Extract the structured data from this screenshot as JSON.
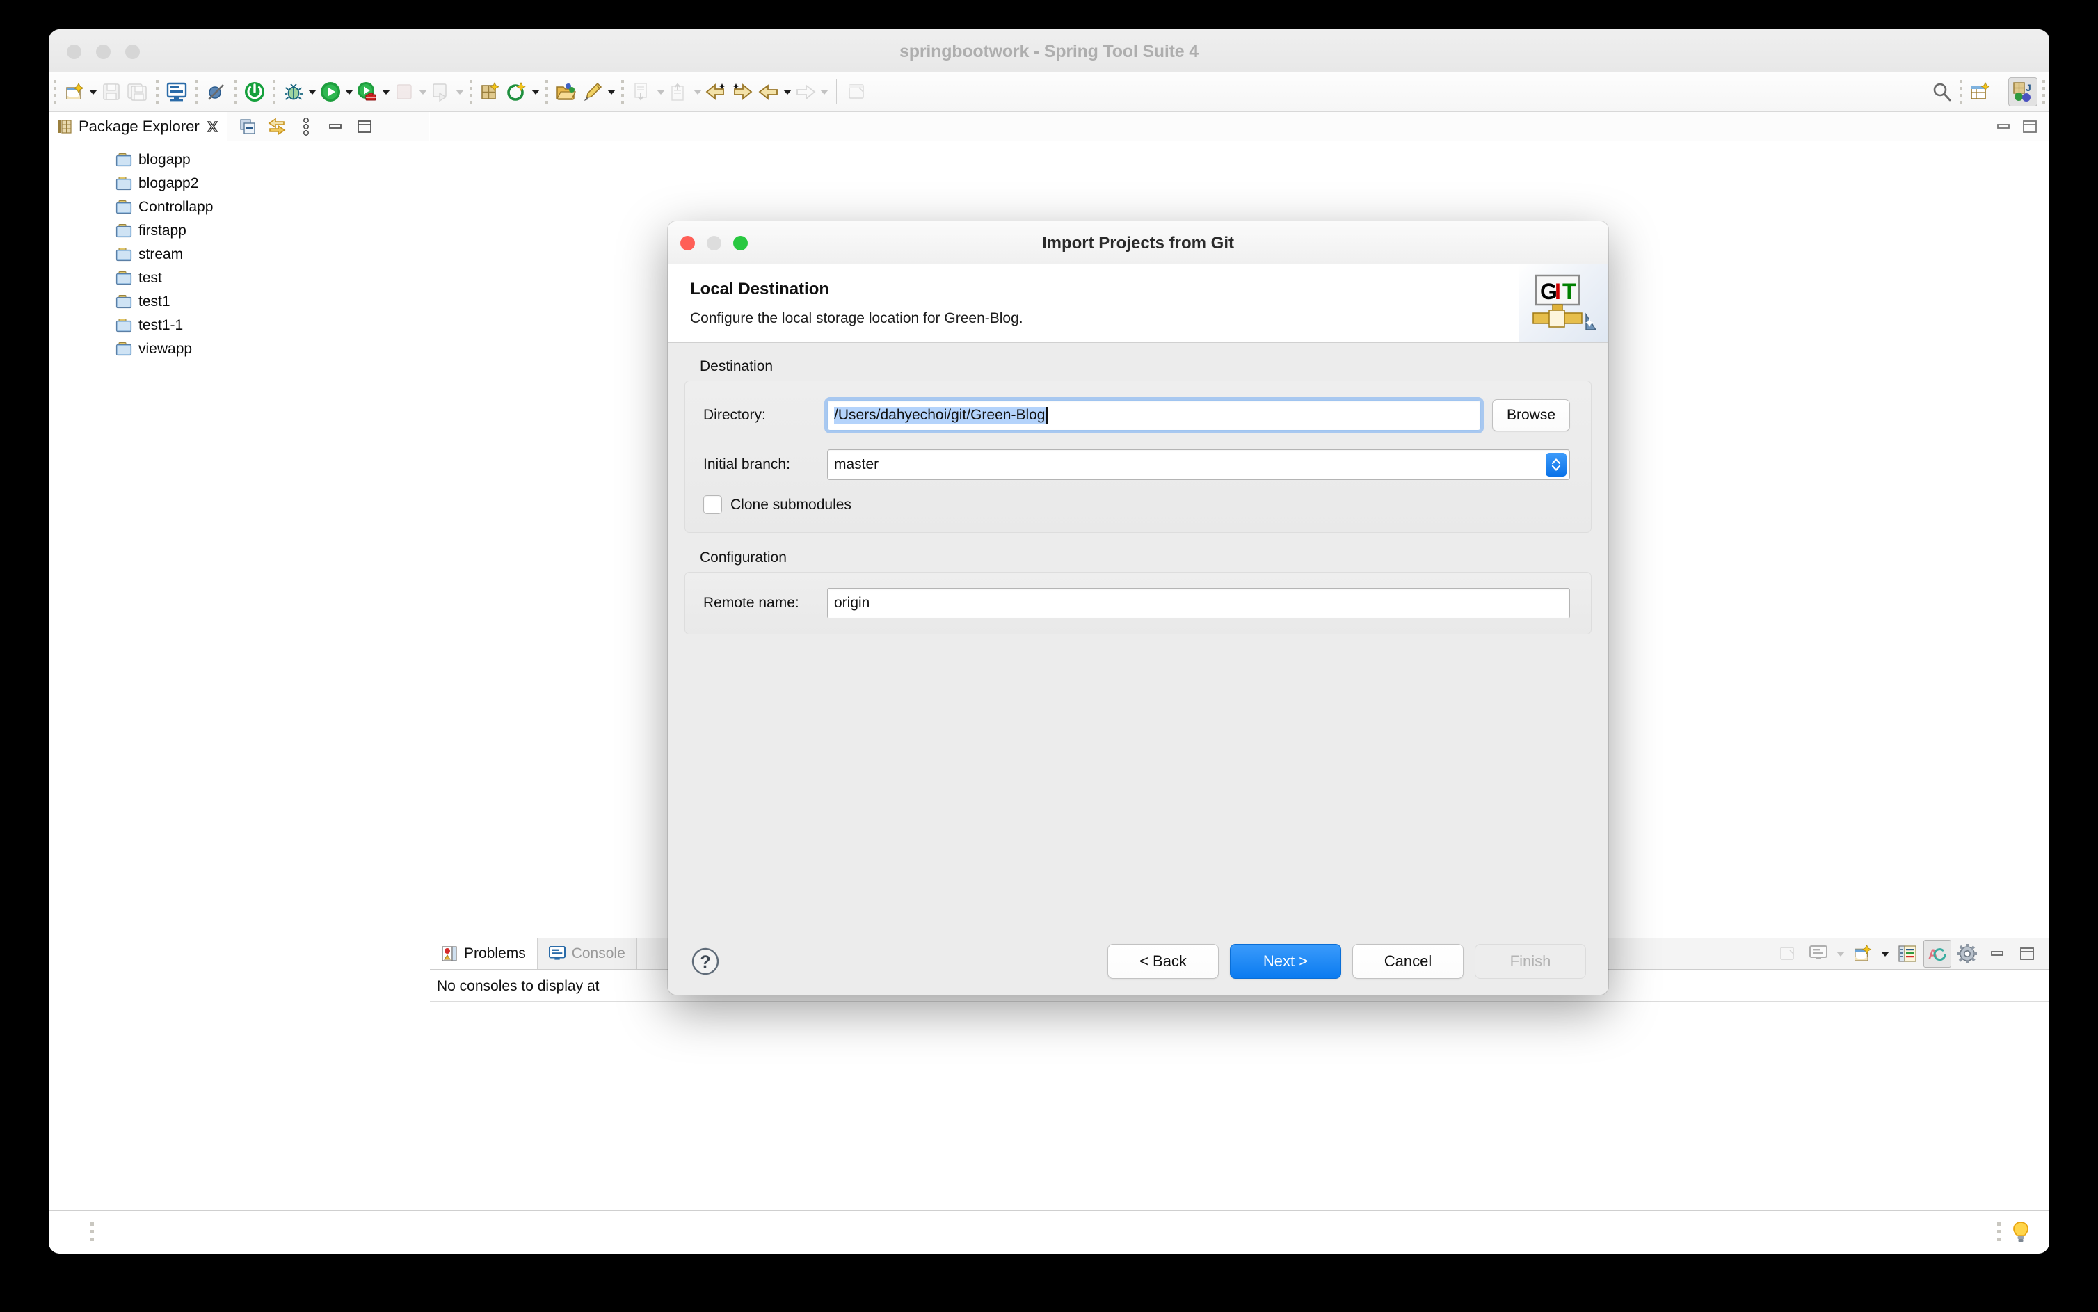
{
  "window": {
    "title": "springbootwork - Spring Tool Suite 4"
  },
  "toolbar": {
    "items": [
      {
        "name": "new-wizard-icon",
        "label": "New"
      },
      {
        "name": "save-icon",
        "label": "Save"
      },
      {
        "name": "save-all-icon",
        "label": "Save All"
      },
      {
        "name": "console-icon",
        "label": "Open Console"
      },
      {
        "name": "skip-breakpoints-icon",
        "label": "Skip All Breakpoints"
      },
      {
        "name": "spring-boot-dashboard-icon",
        "label": "Boot Dashboard"
      },
      {
        "name": "debug-icon",
        "label": "Debug"
      },
      {
        "name": "run-icon",
        "label": "Run"
      },
      {
        "name": "run-external-tools-icon",
        "label": "External Tools"
      },
      {
        "name": "stop-icon",
        "label": "Stop"
      },
      {
        "name": "run-last-tool-icon",
        "label": "Run Last Tool"
      },
      {
        "name": "new-java-package-icon",
        "label": "New Java Package"
      },
      {
        "name": "new-class-icon",
        "label": "New Java Class"
      },
      {
        "name": "open-type-icon",
        "label": "Open Type"
      },
      {
        "name": "edit-icon",
        "label": "Edit"
      },
      {
        "name": "next-annotation-icon",
        "label": "Next Annotation"
      },
      {
        "name": "previous-annotation-icon",
        "label": "Previous Annotation"
      },
      {
        "name": "back-edit-icon",
        "label": "Back"
      },
      {
        "name": "forward-edit-icon",
        "label": "Forward"
      },
      {
        "name": "last-edit-location-icon",
        "label": "Last Edit Location"
      },
      {
        "name": "pin-editor-icon",
        "label": "Pin Editor"
      }
    ],
    "right": [
      {
        "name": "search-icon",
        "label": "Search"
      },
      {
        "name": "open-perspective-icon",
        "label": "Open Perspective"
      },
      {
        "name": "java-perspective-icon",
        "label": "Java"
      }
    ]
  },
  "package_explorer": {
    "tab_label": "Package Explorer",
    "tab_icon": "package-explorer-icon",
    "close_icon": "close-icon",
    "tools": [
      {
        "name": "collapse-all-icon",
        "label": "Collapse All"
      },
      {
        "name": "link-with-editor-icon",
        "label": "Link with Editor"
      },
      {
        "name": "view-menu-icon",
        "label": "View Menu"
      },
      {
        "name": "minimize-icon",
        "label": "Minimize"
      },
      {
        "name": "maximize-icon",
        "label": "Maximize"
      }
    ],
    "projects": [
      {
        "name": "blogapp"
      },
      {
        "name": "blogapp2"
      },
      {
        "name": "Controllapp"
      },
      {
        "name": "firstapp"
      },
      {
        "name": "stream"
      },
      {
        "name": "test"
      },
      {
        "name": "test1"
      },
      {
        "name": "test1-1"
      },
      {
        "name": "viewapp"
      }
    ]
  },
  "editor_area": {
    "tools": [
      {
        "name": "minimize-icon",
        "label": "Minimize"
      },
      {
        "name": "maximize-icon",
        "label": "Maximize"
      }
    ]
  },
  "console_panel": {
    "tabs": [
      {
        "label": "Problems",
        "icon": "problems-icon",
        "selected": true
      },
      {
        "label": "Console",
        "icon": "console-view-icon",
        "selected": false
      }
    ],
    "message": "No consoles to display at",
    "tools": [
      {
        "name": "pin-console-icon",
        "label": "Pin Console"
      },
      {
        "name": "display-selected-console-icon",
        "label": "Display Selected Console"
      },
      {
        "name": "open-console-icon",
        "label": "Open Console"
      },
      {
        "name": "word-wrap-icon",
        "label": "Word Wrap"
      },
      {
        "name": "scroll-lock-icon",
        "label": "Scroll Lock"
      },
      {
        "name": "console-settings-icon",
        "label": "Console Settings"
      },
      {
        "name": "minimize-icon",
        "label": "Minimize"
      },
      {
        "name": "maximize-icon",
        "label": "Maximize"
      }
    ]
  },
  "statusbar": {
    "tip_icon": "lightbulb-icon"
  },
  "dialog": {
    "title": "Import Projects from Git",
    "traffic_lights": [
      "close",
      "minimize",
      "zoom"
    ],
    "header": {
      "title": "Local Destination",
      "description": "Configure the local storage location for Green-Blog.",
      "logo": "git-logo",
      "logo_text": {
        "g": "G",
        "i": "I",
        "t": "T"
      }
    },
    "destination": {
      "group_label": "Destination",
      "directory_label": "Directory:",
      "directory_value": "/Users/dahyechoi/git/Green-Blog",
      "browse_label": "Browse",
      "branch_label": "Initial branch:",
      "branch_value": "master",
      "clone_submodules_label": "Clone submodules",
      "clone_submodules_checked": false
    },
    "configuration": {
      "group_label": "Configuration",
      "remote_label": "Remote name:",
      "remote_value": "origin"
    },
    "footer": {
      "help_icon": "help-icon",
      "back_label": "< Back",
      "next_label": "Next >",
      "cancel_label": "Cancel",
      "finish_label": "Finish"
    }
  },
  "colors": {
    "accent_blue": "#0a7bf0",
    "selection_blue": "#b4d3fb",
    "traffic_red": "#ff5f57",
    "traffic_green": "#28c840",
    "git_red": "#cc0000",
    "git_green": "#008000"
  }
}
